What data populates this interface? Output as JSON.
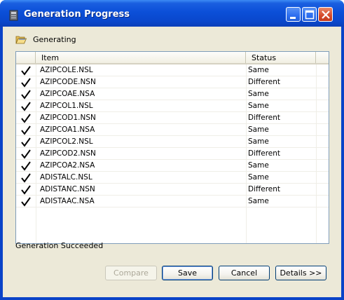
{
  "window": {
    "title": "Generation Progress"
  },
  "icons": {
    "app": "generator-icon",
    "section": "open-folder-icon",
    "check": "checkmark-icon"
  },
  "section_label": "Generating",
  "table": {
    "columns": [
      "Item",
      "Status"
    ],
    "rows": [
      {
        "item": "AZIPCOLE.NSL",
        "status": "Same",
        "checked": true
      },
      {
        "item": "AZIPCODE.NSN",
        "status": "Different",
        "checked": true
      },
      {
        "item": "AZIPCOAE.NSA",
        "status": "Same",
        "checked": true
      },
      {
        "item": "AZIPCOL1.NSL",
        "status": "Same",
        "checked": true
      },
      {
        "item": "AZIPCOD1.NSN",
        "status": "Different",
        "checked": true
      },
      {
        "item": "AZIPCOA1.NSA",
        "status": "Same",
        "checked": true
      },
      {
        "item": "AZIPCOL2.NSL",
        "status": "Same",
        "checked": true
      },
      {
        "item": "AZIPCOD2.NSN",
        "status": "Different",
        "checked": true
      },
      {
        "item": "AZIPCOA2.NSA",
        "status": "Same",
        "checked": true
      },
      {
        "item": "ADISTALC.NSL",
        "status": "Same",
        "checked": true
      },
      {
        "item": "ADISTANC.NSN",
        "status": "Different",
        "checked": true
      },
      {
        "item": "ADISTAAC.NSA",
        "status": "Same",
        "checked": true
      }
    ]
  },
  "result_text": "Generation Succeeded",
  "buttons": {
    "compare": {
      "label": "Compare",
      "enabled": false
    },
    "save": {
      "label": "Save",
      "enabled": true
    },
    "cancel": {
      "label": "Cancel",
      "enabled": true
    },
    "details": {
      "label": "Details >>",
      "enabled": true
    }
  },
  "colors": {
    "titlebar": "#0b4fd8",
    "client_bg": "#ece9d8",
    "close_button": "#d5492a"
  }
}
